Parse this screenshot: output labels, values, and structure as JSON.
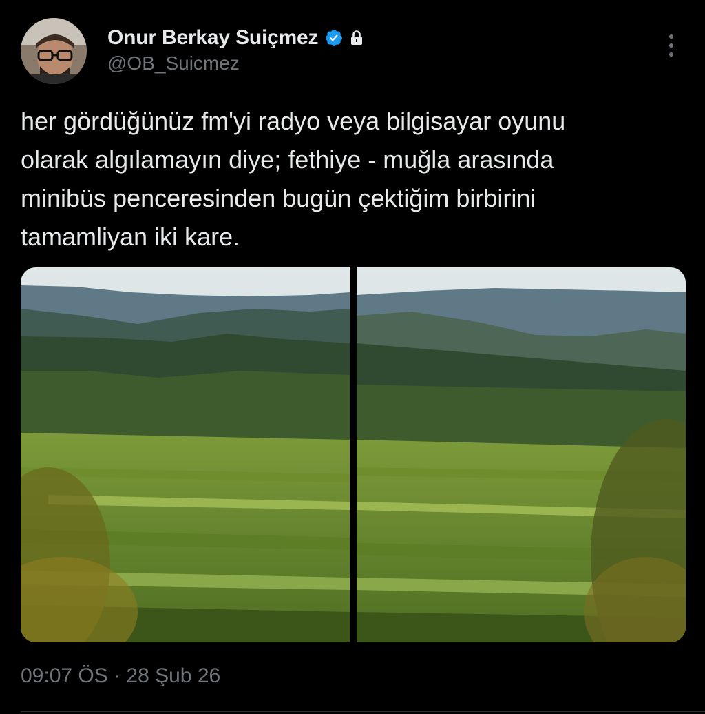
{
  "author": {
    "display_name": "Onur Berkay Suiçmez",
    "handle": "@OB_Suicmez",
    "avatar_icon": "person-avatar",
    "verified_icon": "verified-badge-icon",
    "protected_icon": "lock-icon"
  },
  "tweet": {
    "text": "her gördüğünüz fm'yi radyo veya bilgisayar oyunu\nolarak algılamayın diye; fethiye - muğla arasında\nminibüs penceresinden bugün çektiğim birbirini\ntamamliyan iki kare.",
    "timestamp": "09:07 ÖS · 28 Şub 26"
  },
  "media": {
    "count": 2
  },
  "colors": {
    "background": "#000000",
    "text": "#e7e9ea",
    "secondary_text": "#71767b",
    "verified_blue": "#1d9bf0"
  }
}
